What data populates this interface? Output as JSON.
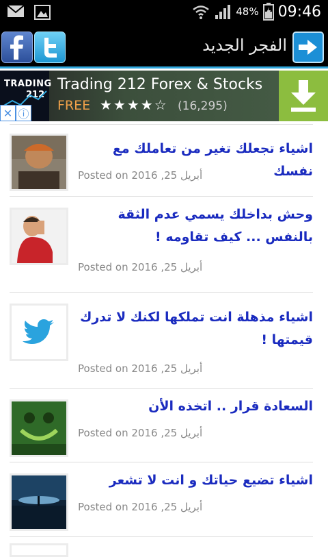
{
  "status_bar": {
    "battery_pct": "48%",
    "time": "09:46",
    "icons": [
      "mail-icon",
      "gallery-icon",
      "wifi-icon",
      "signal-icon",
      "battery-icon"
    ]
  },
  "app_bar": {
    "title": "الفجر الجديد",
    "facebook_icon": "facebook-icon",
    "twitter_icon": "twitter-icon",
    "share_icon": "share-arrow-icon"
  },
  "ad": {
    "logo_line1": "TRADING",
    "logo_line2": "212",
    "title": "Trading 212 Forex & Stocks",
    "price": "FREE",
    "stars": "★★★★☆",
    "rating_count": "(16,295)",
    "download_icon": "download-icon"
  },
  "posts": [
    {
      "title": "اشياء تجعلك تغير من تعاملك مع نفسك",
      "date": "أبريل 25, 2016",
      "posted_prefix": "Posted on"
    },
    {
      "title": "وحش بداخلك يسمي عدم الثقة بالنفس ... كيف تقاومه !",
      "date": "أبريل 25, 2016",
      "posted_prefix": "Posted on"
    },
    {
      "title": "اشياء مذهلة انت تملكها لكنك لا تدرك قيمتها !",
      "date": "أبريل 25, 2016",
      "posted_prefix": "Posted on"
    },
    {
      "title": "السعادة قرار .. اتخذه الأن",
      "date": "أبريل 25, 2016",
      "posted_prefix": "Posted on"
    },
    {
      "title": "اشياء تضيع حياتك و انت لا تشعر",
      "date": "أبريل 25, 2016",
      "posted_prefix": "Posted on"
    }
  ],
  "colors": {
    "title_blue": "#1a2bbf",
    "accent_line": "#2fa6dc",
    "ad_green": "#8cbd3f",
    "free_orange": "#f2a24a"
  }
}
